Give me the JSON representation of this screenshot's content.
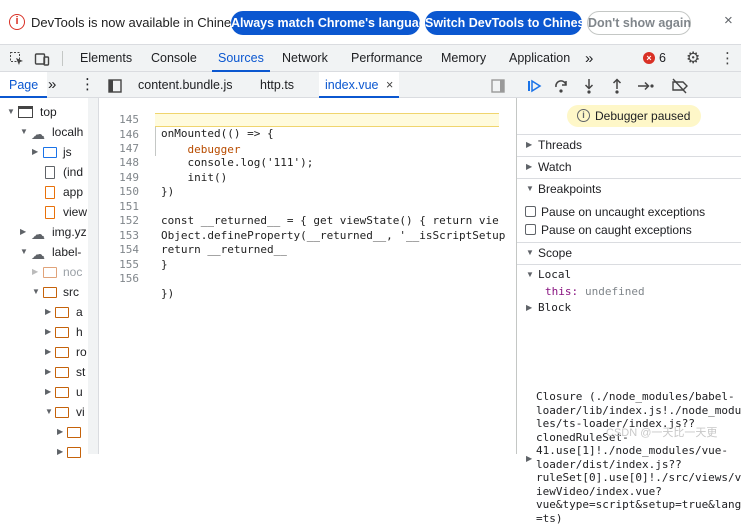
{
  "infobar": {
    "icon": "info-icon",
    "message": "DevTools is now available in Chinese!",
    "always_match_label": "Always match Chrome's language",
    "switch_label": "Switch DevTools to Chinese",
    "dont_show_label": "Don't show again",
    "close_glyph": "×"
  },
  "main_tabs": {
    "items": [
      "Elements",
      "Console",
      "Sources",
      "Network",
      "Performance",
      "Memory",
      "Application"
    ],
    "active": "Sources",
    "more_glyph": "»",
    "error_count": "6",
    "error_icon_glyph": "×",
    "kebab_glyph": "⋮",
    "gear_glyph": "⚙"
  },
  "navigator": {
    "tab_label": "Page",
    "more_glyph": "»",
    "kebab_glyph": "⋮",
    "tree": [
      {
        "label": "top",
        "icon": "frame-icon"
      },
      {
        "label": "localh",
        "icon": "cloud-icon"
      },
      {
        "label": "js",
        "icon": "folder-icon"
      },
      {
        "label": "(ind",
        "icon": "file-icon"
      },
      {
        "label": "app",
        "icon": "file-icon"
      },
      {
        "label": "view",
        "icon": "file-icon"
      },
      {
        "label": "img.yz",
        "icon": "cloud-icon"
      },
      {
        "label": "label-",
        "icon": "cloud-icon"
      },
      {
        "label": "noc",
        "icon": "folder-icon"
      },
      {
        "label": "src",
        "icon": "folder-icon"
      },
      {
        "label": "a",
        "icon": "folder-icon"
      },
      {
        "label": "h",
        "icon": "folder-icon"
      },
      {
        "label": "ro",
        "icon": "folder-icon"
      },
      {
        "label": "st",
        "icon": "folder-icon"
      },
      {
        "label": "u",
        "icon": "folder-icon"
      },
      {
        "label": "vi",
        "icon": "folder-icon"
      }
    ]
  },
  "editor": {
    "tabs": [
      "content.bundle.js",
      "http.ts",
      "index.vue"
    ],
    "active_tab": "index.vue",
    "close_glyph": "×",
    "lines": [
      {
        "num": "145",
        "text": "onMounted(() => {"
      },
      {
        "num": "146",
        "text": "    debugger"
      },
      {
        "num": "147",
        "text": "    console.log('111');"
      },
      {
        "num": "148",
        "text": "    init()"
      },
      {
        "num": "149",
        "text": "})"
      },
      {
        "num": "150",
        "text": ""
      },
      {
        "num": "151",
        "text": "const __returned__ = { get viewState() { return vie"
      },
      {
        "num": "152",
        "text": "Object.defineProperty(__returned__, '__isScriptSetup"
      },
      {
        "num": "153",
        "text": "return __returned__"
      },
      {
        "num": "154",
        "text": "}"
      },
      {
        "num": "155",
        "text": ""
      },
      {
        "num": "156",
        "text": "})"
      }
    ],
    "highlighted_line": "146"
  },
  "debugger": {
    "paused_label": "Debugger paused",
    "sections": {
      "threads": "Threads",
      "watch": "Watch",
      "breakpoints": "Breakpoints",
      "scope": "Scope"
    },
    "pause_uncaught": "Pause on uncaught exceptions",
    "pause_caught": "Pause on caught exceptions",
    "local_label": "Local",
    "this_key": "this:",
    "this_value": "undefined",
    "block_label": "Block",
    "closure_text": "Closure (./node_modules/babel-\nloader/lib/index.js!./node_modu\nles/ts-loader/index.js??\nclonedRuleSet-\n41.use[1]!./node_modules/vue-\nloader/dist/index.js??\nruleSet[0].use[0]!./src/views/v\niewVideo/index.vue?\nvue&type=script&setup=true&lang\n=ts)"
  },
  "watermark": "CSDN @一天比一天更"
}
